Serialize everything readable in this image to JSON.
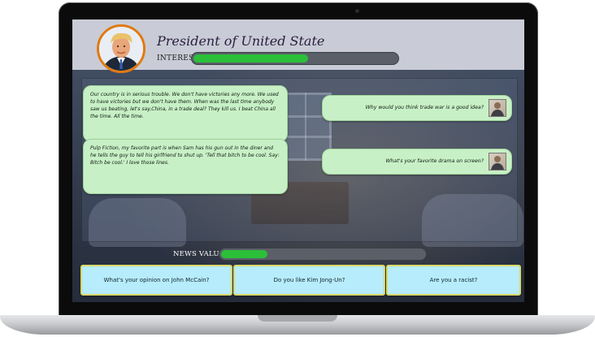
{
  "header": {
    "title": "President of United State",
    "interest_label": "INTEREST",
    "interest_level": 0.57
  },
  "dialogue": {
    "responses": [
      "Our country is in serious trouble. We don't have victories any more. We used to have victories but we don't have them. When was the last time anybody saw us beating, let's say,China, in a trade deal? They kill us. I beat China all the time. All the time.",
      "Pulp Fiction, my favorite part is when Sam has his gun out in the diner and he tells the guy to tell his girlfriend to shut up. 'Tell that bitch to be cool. Say: Bitch be cool.' I love those lines."
    ],
    "questions": [
      "Why would you think trade war is a good idea?",
      "What's your favorite drama on screen?"
    ]
  },
  "news": {
    "label": "NEWS VALUE",
    "level": 0.24
  },
  "answers": [
    "What's your opinion on John McCain?",
    "Do you like Kim Jong-Un?",
    "Are you a racist?"
  ],
  "colors": {
    "bar_fill": "#2bbf3a",
    "bubble_bg": "#c8f0c6",
    "answer_bg": "#b6ecfb",
    "avatar_ring": "#e07a12"
  }
}
